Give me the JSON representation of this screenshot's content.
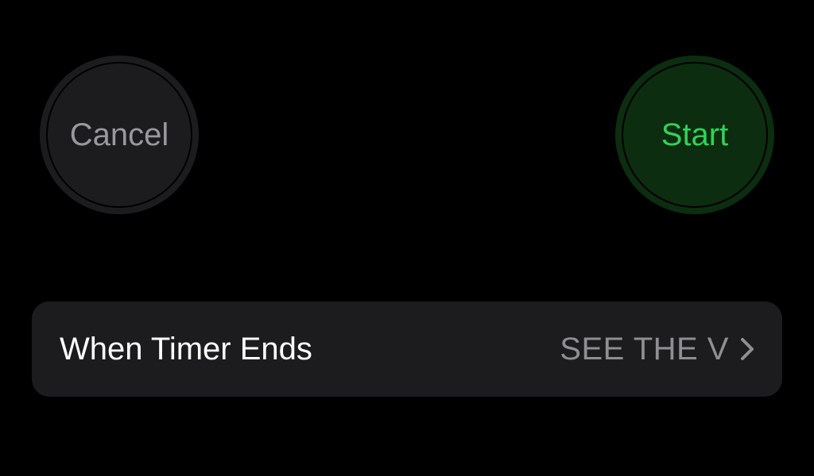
{
  "buttons": {
    "cancel_label": "Cancel",
    "start_label": "Start"
  },
  "settings": {
    "when_timer_ends_label": "When Timer Ends",
    "when_timer_ends_value": "SEE THE V"
  }
}
